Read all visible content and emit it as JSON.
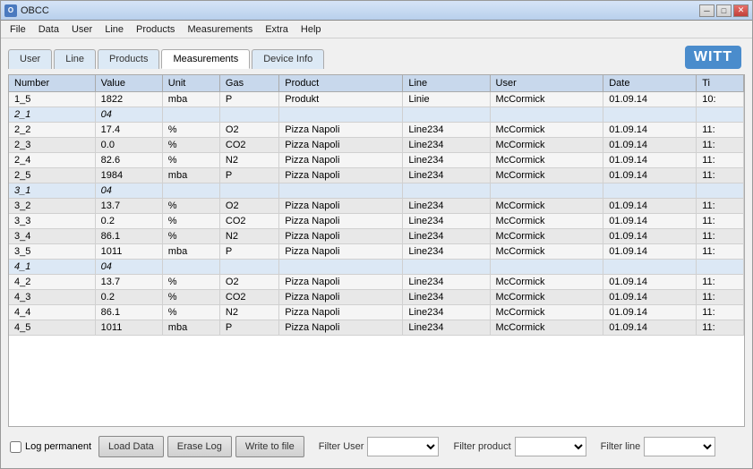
{
  "window": {
    "title": "OBCC",
    "icon": "O"
  },
  "titlebar": {
    "controls": {
      "minimize": "─",
      "maximize": "□",
      "close": "✕"
    }
  },
  "menubar": {
    "items": [
      "File",
      "Data",
      "User",
      "Line",
      "Products",
      "Measurements",
      "Extra",
      "Help"
    ]
  },
  "logo": "WITT",
  "tabs": [
    {
      "label": "User",
      "active": false
    },
    {
      "label": "Line",
      "active": false
    },
    {
      "label": "Products",
      "active": false
    },
    {
      "label": "Measurements",
      "active": true
    },
    {
      "label": "Device Info",
      "active": false
    }
  ],
  "table": {
    "columns": [
      "Number",
      "Value",
      "Unit",
      "Gas",
      "Product",
      "Line",
      "User",
      "Date",
      "Ti"
    ],
    "rows": [
      {
        "number": "1_5",
        "value": "1822",
        "unit": "mba",
        "gas": "P",
        "product": "Produkt",
        "line": "Linie",
        "user": "McCormick",
        "date": "01.09.14",
        "ti": "10:",
        "style": "normal"
      },
      {
        "number": "2_1",
        "value": "04",
        "unit": "",
        "gas": "",
        "product": "",
        "line": "",
        "user": "",
        "date": "",
        "ti": "",
        "style": "group"
      },
      {
        "number": "2_2",
        "value": "17.4",
        "unit": "%",
        "gas": "O2",
        "product": "Pizza Napoli",
        "line": "Line234",
        "user": "McCormick",
        "date": "01.09.14",
        "ti": "11:",
        "style": "normal"
      },
      {
        "number": "2_3",
        "value": "0.0",
        "unit": "%",
        "gas": "CO2",
        "product": "Pizza Napoli",
        "line": "Line234",
        "user": "McCormick",
        "date": "01.09.14",
        "ti": "11:",
        "style": "normal"
      },
      {
        "number": "2_4",
        "value": "82.6",
        "unit": "%",
        "gas": "N2",
        "product": "Pizza Napoli",
        "line": "Line234",
        "user": "McCormick",
        "date": "01.09.14",
        "ti": "11:",
        "style": "normal"
      },
      {
        "number": "2_5",
        "value": "1984",
        "unit": "mba",
        "gas": "P",
        "product": "Pizza Napoli",
        "line": "Line234",
        "user": "McCormick",
        "date": "01.09.14",
        "ti": "11:",
        "style": "normal"
      },
      {
        "number": "3_1",
        "value": "04",
        "unit": "",
        "gas": "",
        "product": "",
        "line": "",
        "user": "",
        "date": "",
        "ti": "",
        "style": "group"
      },
      {
        "number": "3_2",
        "value": "13.7",
        "unit": "%",
        "gas": "O2",
        "product": "Pizza Napoli",
        "line": "Line234",
        "user": "McCormick",
        "date": "01.09.14",
        "ti": "11:",
        "style": "normal"
      },
      {
        "number": "3_3",
        "value": "0.2",
        "unit": "%",
        "gas": "CO2",
        "product": "Pizza Napoli",
        "line": "Line234",
        "user": "McCormick",
        "date": "01.09.14",
        "ti": "11:",
        "style": "normal"
      },
      {
        "number": "3_4",
        "value": "86.1",
        "unit": "%",
        "gas": "N2",
        "product": "Pizza Napoli",
        "line": "Line234",
        "user": "McCormick",
        "date": "01.09.14",
        "ti": "11:",
        "style": "normal"
      },
      {
        "number": "3_5",
        "value": "1011",
        "unit": "mba",
        "gas": "P",
        "product": "Pizza Napoli",
        "line": "Line234",
        "user": "McCormick",
        "date": "01.09.14",
        "ti": "11:",
        "style": "normal"
      },
      {
        "number": "4_1",
        "value": "04",
        "unit": "",
        "gas": "",
        "product": "",
        "line": "",
        "user": "",
        "date": "",
        "ti": "",
        "style": "group"
      },
      {
        "number": "4_2",
        "value": "13.7",
        "unit": "%",
        "gas": "O2",
        "product": "Pizza Napoli",
        "line": "Line234",
        "user": "McCormick",
        "date": "01.09.14",
        "ti": "11:",
        "style": "normal"
      },
      {
        "number": "4_3",
        "value": "0.2",
        "unit": "%",
        "gas": "CO2",
        "product": "Pizza Napoli",
        "line": "Line234",
        "user": "McCormick",
        "date": "01.09.14",
        "ti": "11:",
        "style": "normal"
      },
      {
        "number": "4_4",
        "value": "86.1",
        "unit": "%",
        "gas": "N2",
        "product": "Pizza Napoli",
        "line": "Line234",
        "user": "McCormick",
        "date": "01.09.14",
        "ti": "11:",
        "style": "normal"
      },
      {
        "number": "4_5",
        "value": "1011",
        "unit": "mba",
        "gas": "P",
        "product": "Pizza Napoli",
        "line": "Line234",
        "user": "McCormick",
        "date": "01.09.14",
        "ti": "11:",
        "style": "normal"
      }
    ]
  },
  "bottom": {
    "log_permanent_label": "Log permanent",
    "filter_user_label": "Filter User",
    "filter_product_label": "Filter product",
    "filter_line_label": "Filter line",
    "buttons": {
      "load_data": "Load Data",
      "erase_log": "Erase Log",
      "write_to_file": "Write to file"
    }
  }
}
